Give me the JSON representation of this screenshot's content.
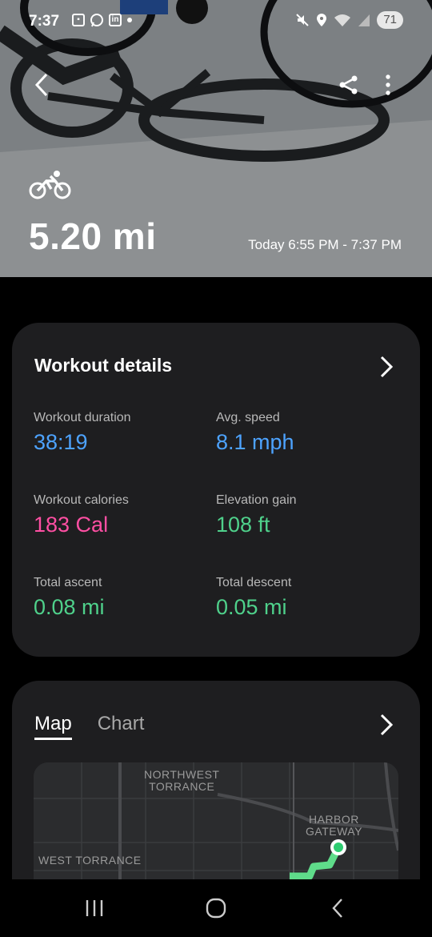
{
  "status_bar": {
    "time": "7:37",
    "battery": "71",
    "left_icons": [
      "app-icon",
      "whatsapp-icon",
      "linkedin-icon",
      "dot-icon"
    ],
    "right_icons": [
      "mute-icon",
      "location-icon",
      "wifi-icon",
      "signal-icon"
    ]
  },
  "header": {
    "distance": "5.20 mi",
    "time_range": "Today 6:55 PM - 7:37 PM",
    "activity_icon": "bike-icon"
  },
  "workout_details": {
    "title": "Workout details",
    "metrics": [
      {
        "label": "Workout duration",
        "value": "38:19",
        "color": "#4da3ff"
      },
      {
        "label": "Avg. speed",
        "value": "8.1 mph",
        "color": "#4da3ff"
      },
      {
        "label": "Workout calories",
        "value": "183 Cal",
        "color": "#ff4fa3"
      },
      {
        "label": "Elevation gain",
        "value": "108 ft",
        "color": "#4fd18b"
      },
      {
        "label": "Total ascent",
        "value": "0.08 mi",
        "color": "#4fd18b"
      },
      {
        "label": "Total descent",
        "value": "0.05 mi",
        "color": "#4fd18b"
      }
    ]
  },
  "map_card": {
    "tabs": [
      "Map",
      "Chart"
    ],
    "active_tab": "Map",
    "labels": {
      "northwest_torrance": "NORTHWEST\nTORRANCE",
      "harbor_gateway": "HARBOR\nGATEWAY",
      "west_torrance": "WEST TORRANCE"
    }
  }
}
